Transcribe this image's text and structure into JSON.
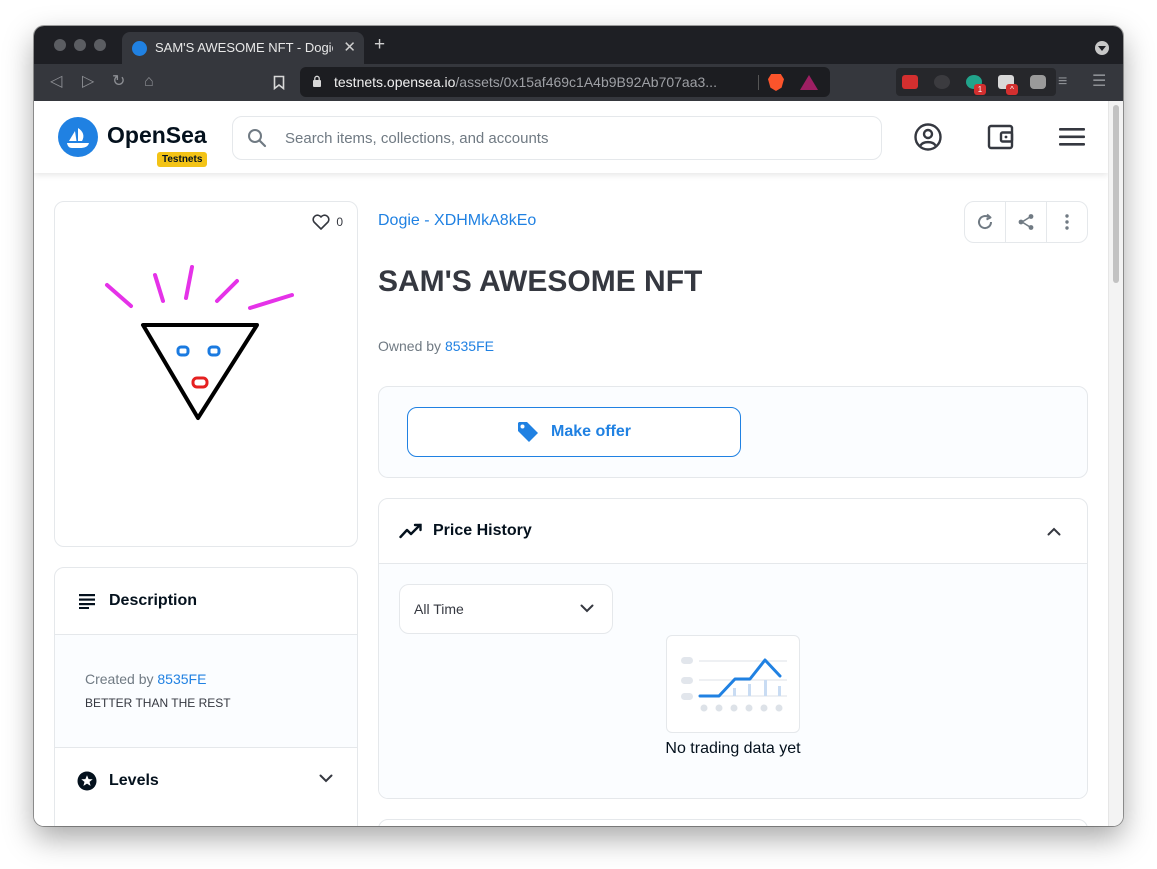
{
  "browser": {
    "tab_title": "SAM'S AWESOME NFT - Dogie",
    "url_host": "testnets.opensea.io",
    "url_path": "/assets/0x15af469c1A4b9B92Ab707aa3...",
    "extension_badge_count": "1"
  },
  "header": {
    "logo_text": "OpenSea",
    "network_badge": "Testnets",
    "search_placeholder": "Search items, collections, and accounts"
  },
  "asset": {
    "favorites_count": "0",
    "collection": "Dogie - XDHMkA8kEo",
    "title": "SAM'S AWESOME NFT",
    "owned_by_label": "Owned by",
    "owner": "8535FE"
  },
  "description": {
    "heading": "Description",
    "created_by_label": "Created by",
    "creator": "8535FE",
    "text": "BETTER THAN THE REST"
  },
  "levels": {
    "heading": "Levels"
  },
  "offer": {
    "button_label": "Make offer"
  },
  "price_history": {
    "heading": "Price History",
    "range_selected": "All Time",
    "empty_message": "No trading data yet"
  },
  "colors": {
    "accent": "#2081e2",
    "badge": "#f3c316",
    "text_dark": "#04111d",
    "text_muted": "#707a83"
  }
}
